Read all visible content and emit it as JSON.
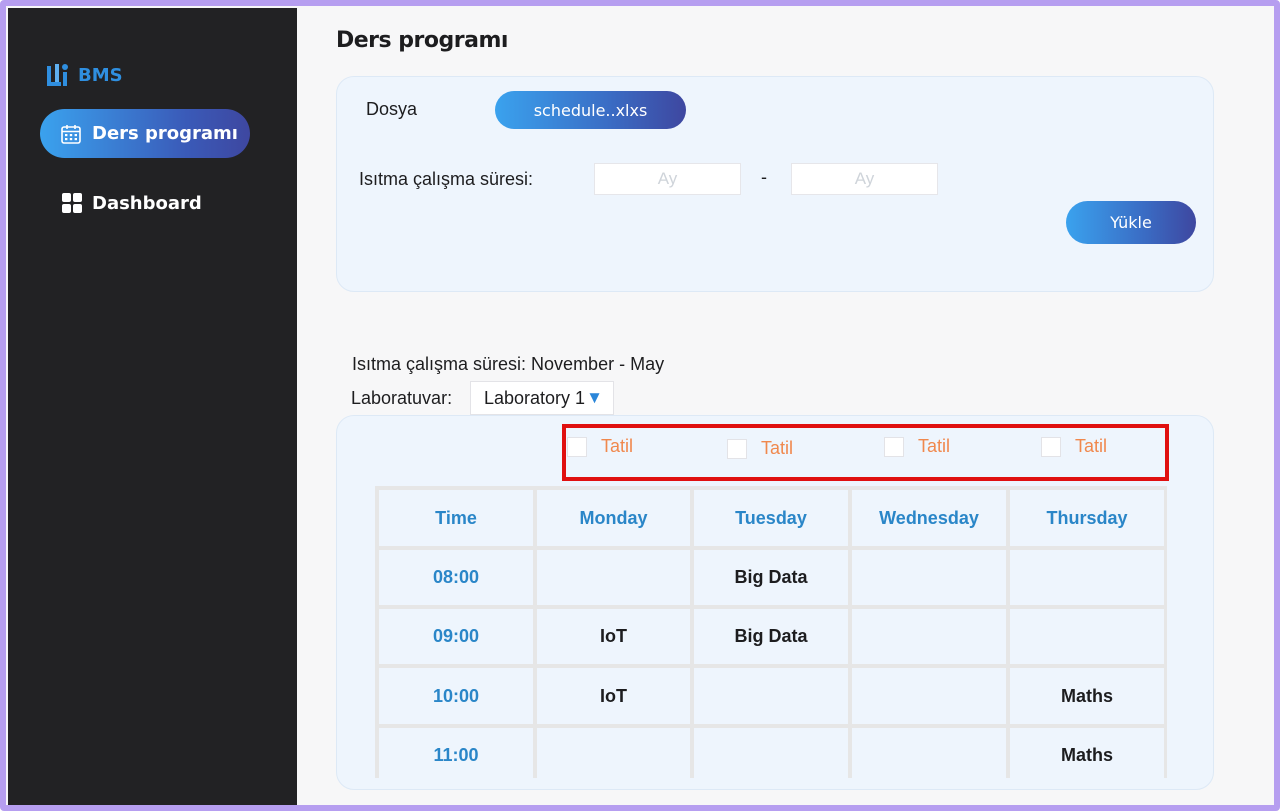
{
  "app": {
    "brand": "BMS"
  },
  "sidebar": {
    "items": [
      {
        "label": "Ders programı",
        "icon": "calendar-icon",
        "active": true
      },
      {
        "label": "Dashboard",
        "icon": "grid-icon",
        "active": false
      }
    ]
  },
  "page": {
    "title": "Ders programı"
  },
  "upload": {
    "file_label": "Dosya",
    "file_name": "schedule..xlxs",
    "period_label": "Isıtma çalışma süresi:",
    "start_placeholder": "Ay",
    "separator": "-",
    "end_placeholder": "Ay",
    "load_button": "Yükle"
  },
  "schedule": {
    "period_text": "Isıtma çalışma süresi: November - May",
    "lab_label": "Laboratuvar:",
    "lab_selected": "Laboratory 1",
    "holiday_label": "Tatil",
    "holidays": [
      {
        "label": "Tatil",
        "checked": false
      },
      {
        "label": "Tatil",
        "checked": false
      },
      {
        "label": "Tatil",
        "checked": false
      },
      {
        "label": "Tatil",
        "checked": false
      }
    ],
    "headers": [
      "Time",
      "Monday",
      "Tuesday",
      "Wednesday",
      "Thursday"
    ],
    "rows": [
      {
        "time": "08:00",
        "cells": [
          "",
          "Big Data",
          "",
          ""
        ]
      },
      {
        "time": "09:00",
        "cells": [
          "IoT",
          "Big Data",
          "",
          ""
        ]
      },
      {
        "time": "10:00",
        "cells": [
          "IoT",
          "",
          "",
          "Maths"
        ]
      },
      {
        "time": "11:00",
        "cells": [
          "",
          "",
          "",
          "Maths"
        ]
      }
    ]
  },
  "colors": {
    "sidebar_bg": "#222224",
    "accent_blue": "#2a86c8",
    "holiday_orange": "#f0884d",
    "highlight_red": "#e01010",
    "card_bg": "#eef5fd"
  }
}
